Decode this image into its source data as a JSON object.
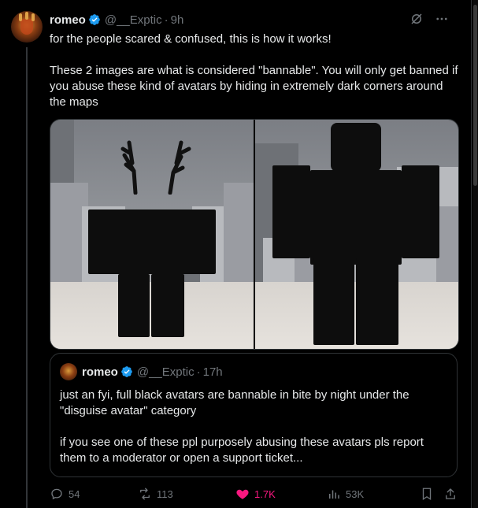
{
  "tweet": {
    "author_name": "romeo",
    "author_handle": "@__Exptic",
    "separator": "·",
    "time": "9h",
    "text_line1": "for the people scared & confused, this is how it works!",
    "text_line2": "These 2 images are what is considered \"bannable\". You will only get banned if you abuse these kind of avatars by hiding in extremely dark corners around the maps"
  },
  "quote": {
    "author_name": "romeo",
    "author_handle": "@__Exptic",
    "separator": "·",
    "time": "17h",
    "text_line1": "just an fyi, full black avatars are bannable in bite by night under the \"disguise avatar\" category",
    "text_line2": "if you see one of these ppl purposely abusing these avatars pls report them to a moderator or open a support ticket..."
  },
  "actions": {
    "replies": "54",
    "reposts": "113",
    "likes": "1.7K",
    "views": "53K"
  },
  "colors": {
    "background": "#000000",
    "text": "#e7e9ea",
    "muted": "#71767b",
    "like_active": "#f91880",
    "verified": "#1d9bf0"
  },
  "icons": [
    "verified-badge-icon",
    "grok-icon",
    "more-icon",
    "reply-icon",
    "repost-icon",
    "like-icon",
    "views-icon",
    "bookmark-icon",
    "share-icon"
  ]
}
